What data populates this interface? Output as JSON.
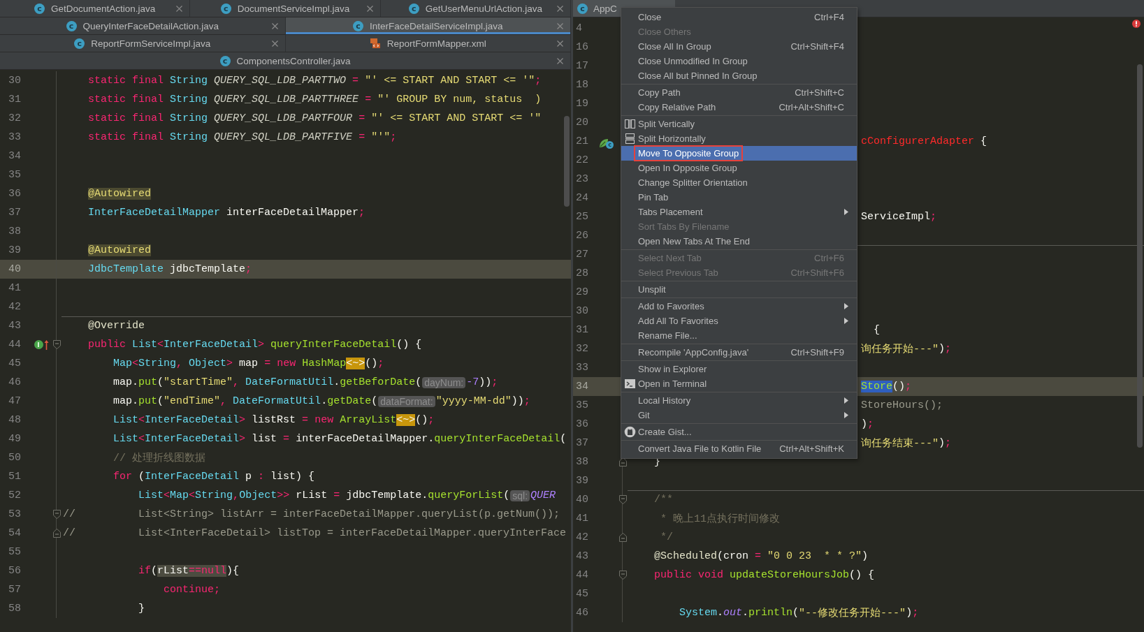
{
  "left_pane": {
    "tab_rows": [
      {
        "tabs": [
          {
            "label": "GetDocumentAction.java",
            "selected": false,
            "icon": {
              "kind": "class",
              "text": "c"
            }
          },
          {
            "label": "DocumentServiceImpl.java",
            "selected": false,
            "icon": {
              "kind": "class",
              "text": "c"
            }
          },
          {
            "label": "GetUserMenuUrlAction.java",
            "selected": false,
            "icon": {
              "kind": "class",
              "text": "c"
            }
          }
        ]
      },
      {
        "tabs": [
          {
            "label": "QueryInterFaceDetailAction.java",
            "selected": false,
            "icon": {
              "kind": "class",
              "text": "c"
            }
          },
          {
            "label": "InterFaceDetailServiceImpl.java",
            "selected": true,
            "icon": {
              "kind": "class",
              "text": "c"
            }
          }
        ]
      },
      {
        "tabs": [
          {
            "label": "ReportFormServiceImpl.java",
            "selected": false,
            "icon": {
              "kind": "class",
              "text": "c"
            }
          },
          {
            "label": "ReportFormMapper.xml",
            "selected": false,
            "icon": {
              "kind": "xml"
            }
          }
        ]
      },
      {
        "tabs": [
          {
            "label": "ComponentsController.java",
            "selected": false,
            "icon": {
              "kind": "class",
              "text": "c"
            }
          }
        ]
      }
    ],
    "lines": [
      {
        "number": "30",
        "current": false,
        "separator_above": false,
        "tokens": [
          {
            "kind": "kw",
            "text": "    static final "
          },
          {
            "kind": "type",
            "text": "String "
          },
          {
            "kind": "const",
            "text": "QUERY_SQL_LDB_PARTTWO"
          },
          {
            "kind": "op",
            "text": " = "
          },
          {
            "kind": "str",
            "text": "\"' <= START AND START <= '\""
          },
          {
            "kind": "op",
            "text": ";"
          }
        ]
      },
      {
        "number": "31",
        "current": false,
        "separator_above": false,
        "tokens": [
          {
            "kind": "kw",
            "text": "    static final "
          },
          {
            "kind": "type",
            "text": "String "
          },
          {
            "kind": "const",
            "text": "QUERY_SQL_LDB_PARTTHREE"
          },
          {
            "kind": "op",
            "text": " = "
          },
          {
            "kind": "str",
            "text": "\"' GROUP BY num, status  )"
          }
        ]
      },
      {
        "number": "32",
        "current": false,
        "separator_above": false,
        "tokens": [
          {
            "kind": "kw",
            "text": "    static final "
          },
          {
            "kind": "type",
            "text": "String "
          },
          {
            "kind": "const",
            "text": "QUERY_SQL_LDB_PARTFOUR"
          },
          {
            "kind": "op",
            "text": " = "
          },
          {
            "kind": "str",
            "text": "\"' <= START AND START <= '\""
          }
        ]
      },
      {
        "number": "33",
        "current": false,
        "separator_above": false,
        "tokens": [
          {
            "kind": "kw",
            "text": "    static final "
          },
          {
            "kind": "type",
            "text": "String "
          },
          {
            "kind": "const",
            "text": "QUERY_SQL_LDB_PARTFIVE"
          },
          {
            "kind": "op",
            "text": " = "
          },
          {
            "kind": "str",
            "text": "\"'\""
          },
          {
            "kind": "op",
            "text": ";"
          }
        ]
      },
      {
        "number": "34",
        "current": false,
        "separator_above": false
      },
      {
        "number": "35",
        "current": false,
        "separator_above": false
      },
      {
        "number": "36",
        "current": false,
        "separator_above": false,
        "tokens": [
          {
            "kind": "ann_hl",
            "text": "    @Autowired"
          }
        ]
      },
      {
        "number": "37",
        "current": false,
        "separator_above": false,
        "tokens": [
          {
            "kind": "type",
            "text": "    InterFaceDetailMapper "
          },
          {
            "kind": "p",
            "text": "interFaceDetailMapper"
          },
          {
            "kind": "op",
            "text": ";"
          }
        ]
      },
      {
        "number": "38",
        "current": false,
        "separator_above": false
      },
      {
        "number": "39",
        "current": false,
        "separator_above": false,
        "tokens": [
          {
            "kind": "ann_hl",
            "text": "    @Autowired"
          }
        ]
      },
      {
        "number": "40",
        "current": true,
        "separator_above": false,
        "tokens": [
          {
            "kind": "type",
            "text": "    JdbcTemplate "
          },
          {
            "kind": "p",
            "text": "jdbcTemplate"
          },
          {
            "kind": "op",
            "text": ";"
          }
        ]
      },
      {
        "number": "41",
        "current": false,
        "separator_above": false
      },
      {
        "number": "42",
        "current": false,
        "separator_above": false
      },
      {
        "number": "43",
        "current": false,
        "separator_above": true,
        "tokens": [
          {
            "kind": "ann",
            "text": "    @Override"
          }
        ]
      },
      {
        "number": "44",
        "current": false,
        "separator_above": false,
        "gutter_icon": {
          "kind": "implements",
          "text": "I"
        },
        "fold": {
          "kind": "start"
        },
        "tokens": [
          {
            "kind": "kw",
            "text": "    public "
          },
          {
            "kind": "type",
            "text": "List"
          },
          {
            "kind": "op",
            "text": "<"
          },
          {
            "kind": "type",
            "text": "InterFaceDetail"
          },
          {
            "kind": "op",
            "text": "> "
          },
          {
            "kind": "method",
            "text": "queryInterFaceDetail"
          },
          {
            "kind": "p",
            "text": "() {"
          }
        ]
      },
      {
        "number": "45",
        "current": false,
        "separator_above": false,
        "tokens": [
          {
            "kind": "type",
            "text": "        Map"
          },
          {
            "kind": "op",
            "text": "<"
          },
          {
            "kind": "type",
            "text": "String"
          },
          {
            "kind": "op",
            "text": ", "
          },
          {
            "kind": "type",
            "text": "Object"
          },
          {
            "kind": "op",
            "text": "> "
          },
          {
            "kind": "p",
            "text": "map "
          },
          {
            "kind": "op",
            "text": "= "
          },
          {
            "kind": "kw",
            "text": "new "
          },
          {
            "kind": "method",
            "text": "HashMap"
          },
          {
            "kind": "diamond",
            "text": "<~>"
          },
          {
            "kind": "p",
            "text": "()"
          },
          {
            "kind": "op",
            "text": ";"
          }
        ]
      },
      {
        "number": "46",
        "current": false,
        "separator_above": false,
        "tokens": [
          {
            "kind": "p",
            "text": "        map."
          },
          {
            "kind": "method",
            "text": "put"
          },
          {
            "kind": "p",
            "text": "("
          },
          {
            "kind": "str",
            "text": "\"startTime\""
          },
          {
            "kind": "op",
            "text": ", "
          },
          {
            "kind": "type",
            "text": "DateFormatUtil"
          },
          {
            "kind": "p",
            "text": "."
          },
          {
            "kind": "method",
            "text": "getBeforDate"
          },
          {
            "kind": "p",
            "text": "("
          },
          {
            "kind": "hint",
            "text": "dayNum:"
          },
          {
            "kind": "num",
            "text": "-7"
          },
          {
            "kind": "p",
            "text": "))"
          },
          {
            "kind": "op",
            "text": ";"
          }
        ]
      },
      {
        "number": "47",
        "current": false,
        "separator_above": false,
        "tokens": [
          {
            "kind": "p",
            "text": "        map."
          },
          {
            "kind": "method",
            "text": "put"
          },
          {
            "kind": "p",
            "text": "("
          },
          {
            "kind": "str",
            "text": "\"endTime\""
          },
          {
            "kind": "op",
            "text": ", "
          },
          {
            "kind": "type",
            "text": "DateFormatUtil"
          },
          {
            "kind": "p",
            "text": "."
          },
          {
            "kind": "method",
            "text": "getDate"
          },
          {
            "kind": "p",
            "text": "("
          },
          {
            "kind": "hint",
            "text": "dataFormat:"
          },
          {
            "kind": "str",
            "text": "\"yyyy-MM-dd\""
          },
          {
            "kind": "p",
            "text": "))"
          },
          {
            "kind": "op",
            "text": ";"
          }
        ]
      },
      {
        "number": "48",
        "current": false,
        "separator_above": false,
        "tokens": [
          {
            "kind": "type",
            "text": "        List"
          },
          {
            "kind": "op",
            "text": "<"
          },
          {
            "kind": "type",
            "text": "InterFaceDetail"
          },
          {
            "kind": "op",
            "text": "> "
          },
          {
            "kind": "p",
            "text": "listRst "
          },
          {
            "kind": "op",
            "text": "= "
          },
          {
            "kind": "kw",
            "text": "new "
          },
          {
            "kind": "method",
            "text": "ArrayList"
          },
          {
            "kind": "diamond",
            "text": "<~>"
          },
          {
            "kind": "p",
            "text": "()"
          },
          {
            "kind": "op",
            "text": ";"
          }
        ]
      },
      {
        "number": "49",
        "current": false,
        "separator_above": false,
        "tokens": [
          {
            "kind": "type",
            "text": "        List"
          },
          {
            "kind": "op",
            "text": "<"
          },
          {
            "kind": "type",
            "text": "InterFaceDetail"
          },
          {
            "kind": "op",
            "text": "> "
          },
          {
            "kind": "p",
            "text": "list "
          },
          {
            "kind": "op",
            "text": "= "
          },
          {
            "kind": "p",
            "text": "interFaceDetailMapper."
          },
          {
            "kind": "method",
            "text": "queryInterFaceDetail"
          },
          {
            "kind": "p",
            "text": "("
          }
        ]
      },
      {
        "number": "50",
        "current": false,
        "separator_above": false,
        "tokens": [
          {
            "kind": "comment",
            "text": "        // 处理折线图数据"
          }
        ]
      },
      {
        "number": "51",
        "current": false,
        "separator_above": false,
        "tokens": [
          {
            "kind": "kw",
            "text": "        for "
          },
          {
            "kind": "p",
            "text": "("
          },
          {
            "kind": "type",
            "text": "InterFaceDetail "
          },
          {
            "kind": "p",
            "text": "p "
          },
          {
            "kind": "op",
            "text": ": "
          },
          {
            "kind": "p",
            "text": "list) {"
          }
        ]
      },
      {
        "number": "52",
        "current": false,
        "separator_above": false,
        "tokens": [
          {
            "kind": "type",
            "text": "            List"
          },
          {
            "kind": "op",
            "text": "<"
          },
          {
            "kind": "type",
            "text": "Map"
          },
          {
            "kind": "op",
            "text": "<"
          },
          {
            "kind": "type",
            "text": "String"
          },
          {
            "kind": "op",
            "text": ","
          },
          {
            "kind": "type",
            "text": "Object"
          },
          {
            "kind": "op",
            "text": ">> "
          },
          {
            "kind": "p",
            "text": "rList "
          },
          {
            "kind": "op",
            "text": "= "
          },
          {
            "kind": "p",
            "text": "jdbcTemplate."
          },
          {
            "kind": "method",
            "text": "queryForList"
          },
          {
            "kind": "p",
            "text": "("
          },
          {
            "kind": "hint",
            "text": "sql:"
          },
          {
            "kind": "static_field",
            "text": "QUER"
          }
        ]
      },
      {
        "number": "53",
        "current": false,
        "separator_above": false,
        "fold": {
          "kind": "start"
        },
        "tokens": [
          {
            "kind": "comment_code",
            "text": "//          List<String> listArr = interFaceDetailMapper.queryList(p.getNum());"
          }
        ]
      },
      {
        "number": "54",
        "current": false,
        "separator_above": false,
        "fold": {
          "kind": "end"
        },
        "tokens": [
          {
            "kind": "comment_code",
            "text": "//          List<InterFaceDetail> listTop = interFaceDetailMapper.queryInterFace"
          }
        ]
      },
      {
        "number": "55",
        "current": false,
        "separator_above": false
      },
      {
        "number": "56",
        "current": false,
        "separator_above": false,
        "tokens": [
          {
            "kind": "kw",
            "text": "            if"
          },
          {
            "kind": "p",
            "text": "("
          },
          {
            "kind": "hl_p",
            "text": "rList"
          },
          {
            "kind": "hl_kw",
            "text": "==null"
          },
          {
            "kind": "p",
            "text": "){"
          }
        ]
      },
      {
        "number": "57",
        "current": false,
        "separator_above": false,
        "tokens": [
          {
            "kind": "kw",
            "text": "                continue"
          },
          {
            "kind": "op",
            "text": ";"
          }
        ]
      },
      {
        "number": "58",
        "current": false,
        "separator_above": false,
        "tokens": [
          {
            "kind": "p",
            "text": "            }"
          }
        ]
      }
    ]
  },
  "right_pane": {
    "tabs": [
      {
        "label": "AppC",
        "selected": true,
        "icon": {
          "kind": "class",
          "text": "c"
        }
      }
    ],
    "lines": [
      {
        "number": "4",
        "current": false,
        "separator_above": false
      },
      {
        "number": "16",
        "current": false,
        "separator_above": false
      },
      {
        "number": "17",
        "current": false,
        "separator_above": false
      },
      {
        "number": "18",
        "current": false,
        "separator_above": false
      },
      {
        "number": "19",
        "current": false,
        "separator_above": false
      },
      {
        "number": "20",
        "current": false,
        "separator_above": false
      },
      {
        "number": "21",
        "current": false,
        "separator_above": false,
        "covered": true,
        "gutter_icon": {
          "kind": "bean",
          "text": "c"
        },
        "tokens": [
          {
            "kind": "error",
            "text": "cConfigurerAdapter"
          },
          {
            "kind": "p",
            "text": " {"
          }
        ]
      },
      {
        "number": "22",
        "current": false,
        "separator_above": false
      },
      {
        "number": "23",
        "current": false,
        "separator_above": false
      },
      {
        "number": "24",
        "current": false,
        "separator_above": false
      },
      {
        "number": "25",
        "current": false,
        "separator_above": false,
        "covered": true,
        "tokens": [
          {
            "kind": "p",
            "text": "ServiceImpl"
          },
          {
            "kind": "op",
            "text": ";"
          }
        ]
      },
      {
        "number": "26",
        "current": false,
        "separator_above": false
      },
      {
        "number": "27",
        "current": false,
        "separator_above": true
      },
      {
        "number": "28",
        "current": false,
        "separator_above": false
      },
      {
        "number": "29",
        "current": false,
        "separator_above": false
      },
      {
        "number": "30",
        "current": false,
        "separator_above": false
      },
      {
        "number": "31",
        "current": false,
        "separator_above": false,
        "covered": true,
        "tokens": [
          {
            "kind": "p",
            "text": "  {"
          }
        ]
      },
      {
        "number": "32",
        "current": false,
        "separator_above": false,
        "covered": true,
        "tokens": [
          {
            "kind": "str",
            "text": "询任务开始---\""
          },
          {
            "kind": "p",
            "text": ")"
          },
          {
            "kind": "op",
            "text": ";"
          }
        ]
      },
      {
        "number": "33",
        "current": false,
        "separator_above": false
      },
      {
        "number": "34",
        "current": true,
        "separator_above": false,
        "covered": true,
        "tokens": [
          {
            "kind": "sel",
            "text": "Store"
          },
          {
            "kind": "p",
            "text": "()"
          },
          {
            "kind": "op",
            "text": ";"
          }
        ]
      },
      {
        "number": "35",
        "current": false,
        "separator_above": false,
        "covered": true,
        "tokens": [
          {
            "kind": "comment_code",
            "text": "StoreHours();"
          }
        ]
      },
      {
        "number": "36",
        "current": false,
        "separator_above": false,
        "covered": true,
        "tokens": [
          {
            "kind": "p",
            "text": ")"
          },
          {
            "kind": "op",
            "text": ";"
          }
        ]
      },
      {
        "number": "37",
        "current": false,
        "separator_above": false,
        "covered": true,
        "tokens": [
          {
            "kind": "str",
            "text": "询任务结束---\""
          },
          {
            "kind": "p",
            "text": ")"
          },
          {
            "kind": "op",
            "text": ";"
          }
        ]
      },
      {
        "number": "38",
        "current": false,
        "separator_above": false,
        "covered": false,
        "fold": {
          "kind": "end"
        },
        "tokens": [
          {
            "kind": "p",
            "text": "    }"
          }
        ]
      },
      {
        "number": "39",
        "current": false,
        "separator_above": false
      },
      {
        "number": "40",
        "current": false,
        "separator_above": true,
        "covered": false,
        "fold": {
          "kind": "start"
        },
        "tokens": [
          {
            "kind": "comment",
            "text": "    /**"
          }
        ]
      },
      {
        "number": "41",
        "current": false,
        "separator_above": false,
        "covered": false,
        "tokens": [
          {
            "kind": "comment",
            "text": "     * 晚上11点执行时间修改"
          }
        ]
      },
      {
        "number": "42",
        "current": false,
        "separator_above": false,
        "covered": false,
        "fold": {
          "kind": "end"
        },
        "tokens": [
          {
            "kind": "comment",
            "text": "     */"
          }
        ]
      },
      {
        "number": "43",
        "current": false,
        "separator_above": false,
        "covered": false,
        "tokens": [
          {
            "kind": "ann",
            "text": "    @Scheduled"
          },
          {
            "kind": "p",
            "text": "(cron "
          },
          {
            "kind": "op",
            "text": "= "
          },
          {
            "kind": "str",
            "text": "\"0 0 23  * * ?\""
          },
          {
            "kind": "p",
            "text": ")"
          }
        ]
      },
      {
        "number": "44",
        "current": false,
        "separator_above": false,
        "covered": false,
        "fold": {
          "kind": "start"
        },
        "tokens": [
          {
            "kind": "kw",
            "text": "    public void "
          },
          {
            "kind": "method",
            "text": "updateStoreHoursJob"
          },
          {
            "kind": "p",
            "text": "() {"
          }
        ]
      },
      {
        "number": "45",
        "current": false,
        "separator_above": false
      },
      {
        "number": "46",
        "current": false,
        "separator_above": false,
        "covered": false,
        "tokens": [
          {
            "kind": "type",
            "text": "        System"
          },
          {
            "kind": "p",
            "text": "."
          },
          {
            "kind": "static_field",
            "text": "out"
          },
          {
            "kind": "p",
            "text": "."
          },
          {
            "kind": "method",
            "text": "println"
          },
          {
            "kind": "p",
            "text": "("
          },
          {
            "kind": "str",
            "text": "\"--修改任务开始---\""
          },
          {
            "kind": "p",
            "text": ")"
          },
          {
            "kind": "op",
            "text": ";"
          }
        ]
      }
    ]
  },
  "context_menu": {
    "groups": [
      {
        "items": [
          {
            "kind": "plain",
            "label": "Close",
            "shortcut": "Ctrl+F4",
            "disabled": false,
            "selected": false,
            "submenu": false,
            "annotated": false
          },
          {
            "kind": "plain",
            "label": "Close Others",
            "disabled": true,
            "selected": false,
            "submenu": false,
            "annotated": false
          },
          {
            "kind": "plain",
            "label": "Close All In Group",
            "shortcut": "Ctrl+Shift+F4",
            "disabled": false,
            "selected": false,
            "submenu": false,
            "annotated": false
          },
          {
            "kind": "plain",
            "label": "Close Unmodified In Group",
            "disabled": false,
            "selected": false,
            "submenu": false,
            "annotated": false
          },
          {
            "kind": "plain",
            "label": "Close All but Pinned In Group",
            "disabled": false,
            "selected": false,
            "submenu": false,
            "annotated": false
          }
        ]
      },
      {
        "items": [
          {
            "kind": "plain",
            "label": "Copy Path",
            "shortcut": "Ctrl+Shift+C",
            "disabled": false,
            "selected": false,
            "submenu": false,
            "annotated": false
          },
          {
            "kind": "plain",
            "label": "Copy Relative Path",
            "shortcut": "Ctrl+Alt+Shift+C",
            "disabled": false,
            "selected": false,
            "submenu": false,
            "annotated": false
          }
        ]
      },
      {
        "items": [
          {
            "kind": "vsplit",
            "label": "Split Vertically",
            "disabled": false,
            "selected": false,
            "submenu": false,
            "annotated": false
          },
          {
            "kind": "hsplit",
            "label": "Split Horizontally",
            "disabled": false,
            "selected": false,
            "submenu": false,
            "annotated": false
          },
          {
            "kind": "plain",
            "label": "Move To Opposite Group",
            "disabled": false,
            "selected": true,
            "submenu": false,
            "annotated": true
          },
          {
            "kind": "plain",
            "label": "Open In Opposite Group",
            "disabled": false,
            "selected": false,
            "submenu": false,
            "annotated": false
          },
          {
            "kind": "plain",
            "label": "Change Splitter Orientation",
            "disabled": false,
            "selected": false,
            "submenu": false,
            "annotated": false
          },
          {
            "kind": "plain",
            "label": "Pin Tab",
            "disabled": false,
            "selected": false,
            "submenu": false,
            "annotated": false
          },
          {
            "kind": "plain",
            "label": "Tabs Placement",
            "disabled": false,
            "selected": false,
            "submenu": true,
            "annotated": false
          },
          {
            "kind": "plain",
            "label": "Sort Tabs By Filename",
            "disabled": true,
            "selected": false,
            "submenu": false,
            "annotated": false
          },
          {
            "kind": "plain",
            "label": "Open New Tabs At The End",
            "disabled": false,
            "selected": false,
            "submenu": false,
            "annotated": false
          }
        ]
      },
      {
        "items": [
          {
            "kind": "plain",
            "label": "Select Next Tab",
            "shortcut": "Ctrl+F6",
            "disabled": true,
            "selected": false,
            "submenu": false,
            "annotated": false
          },
          {
            "kind": "plain",
            "label": "Select Previous Tab",
            "shortcut": "Ctrl+Shift+F6",
            "disabled": true,
            "selected": false,
            "submenu": false,
            "annotated": false
          }
        ]
      },
      {
        "items": [
          {
            "kind": "plain",
            "label": "Unsplit",
            "disabled": false,
            "selected": false,
            "submenu": false,
            "annotated": false
          }
        ]
      },
      {
        "items": [
          {
            "kind": "plain",
            "label": "Add to Favorites",
            "disabled": false,
            "selected": false,
            "submenu": true,
            "annotated": false
          },
          {
            "kind": "plain",
            "label": "Add All To Favorites",
            "disabled": false,
            "selected": false,
            "submenu": true,
            "annotated": false
          },
          {
            "kind": "plain",
            "label": "Rename File...",
            "disabled": false,
            "selected": false,
            "submenu": false,
            "annotated": false
          }
        ]
      },
      {
        "items": [
          {
            "kind": "plain",
            "label": "Recompile 'AppConfig.java'",
            "shortcut": "Ctrl+Shift+F9",
            "disabled": false,
            "selected": false,
            "submenu": false,
            "annotated": false
          }
        ]
      },
      {
        "items": [
          {
            "kind": "plain",
            "label": "Show in Explorer",
            "disabled": false,
            "selected": false,
            "submenu": false,
            "annotated": false
          },
          {
            "kind": "terminal",
            "label": "Open in Terminal",
            "disabled": false,
            "selected": false,
            "submenu": false,
            "annotated": false
          }
        ]
      },
      {
        "items": [
          {
            "kind": "plain",
            "label": "Local History",
            "disabled": false,
            "selected": false,
            "submenu": true,
            "annotated": false
          },
          {
            "kind": "plain",
            "label": "Git",
            "disabled": false,
            "selected": false,
            "submenu": true,
            "annotated": false
          }
        ]
      },
      {
        "items": [
          {
            "kind": "gist",
            "label": "Create Gist...",
            "disabled": false,
            "selected": false,
            "submenu": false,
            "annotated": false
          }
        ]
      },
      {
        "items": [
          {
            "kind": "plain",
            "label": "Convert Java File to Kotlin File",
            "shortcut": "Ctrl+Alt+Shift+K",
            "disabled": false,
            "selected": false,
            "submenu": false,
            "annotated": false
          }
        ]
      }
    ]
  }
}
